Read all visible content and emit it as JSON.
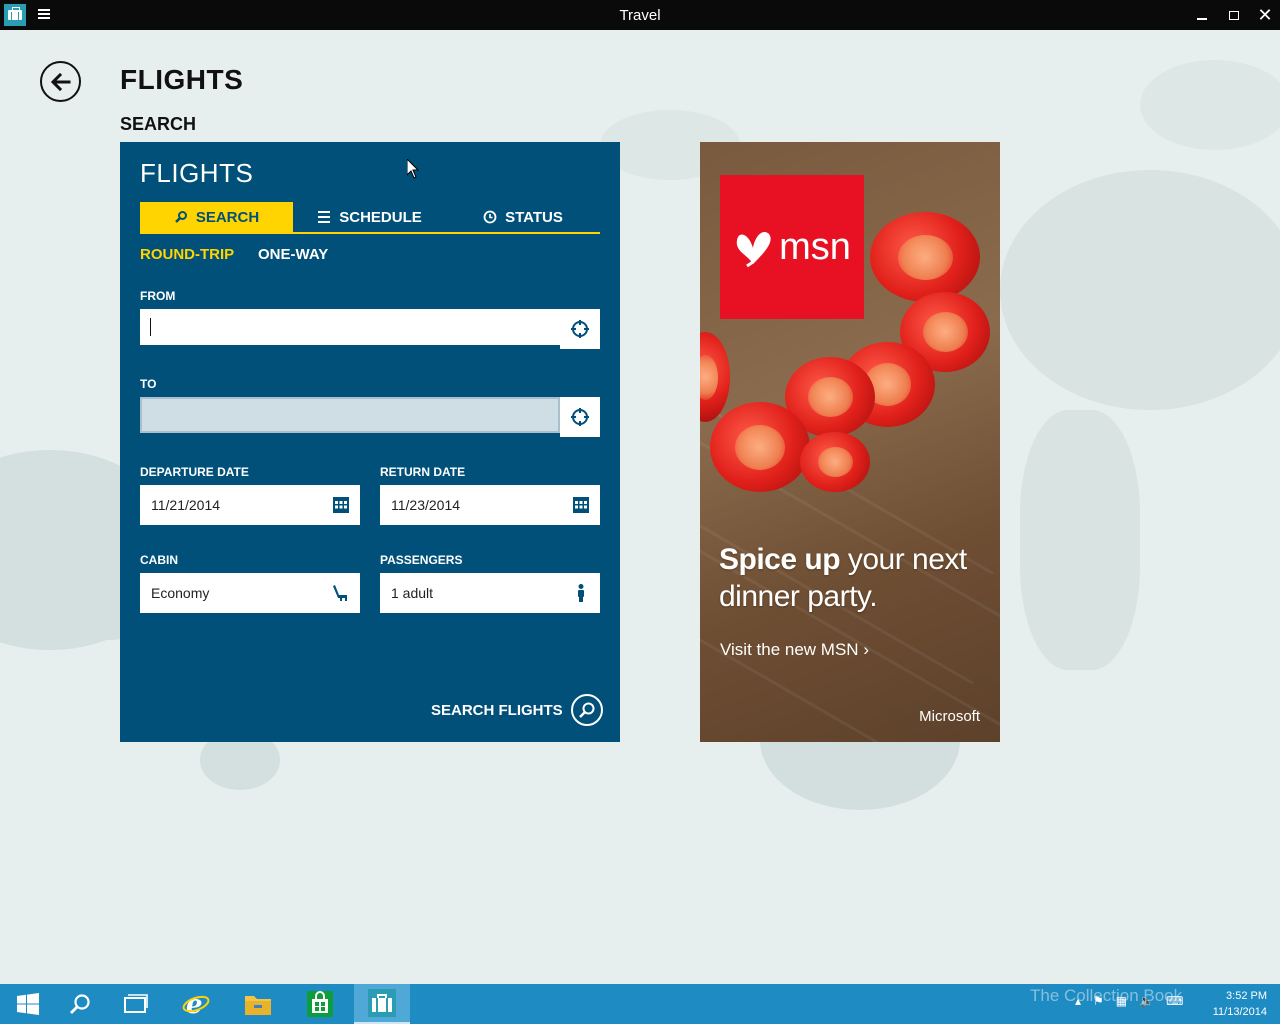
{
  "window": {
    "title": "Travel",
    "minimize_icon": "minimize-icon",
    "maximize_icon": "restore-icon",
    "close_icon": "close-icon"
  },
  "header": {
    "page_title": "FLIGHTS",
    "section_title": "SEARCH"
  },
  "panel": {
    "title": "FLIGHTS",
    "tabs": [
      {
        "label": "SEARCH",
        "icon": "search-icon",
        "active": true
      },
      {
        "label": "SCHEDULE",
        "icon": "list-icon",
        "active": false
      },
      {
        "label": "STATUS",
        "icon": "clock-icon",
        "active": false
      }
    ],
    "trip_types": [
      {
        "label": "ROUND-TRIP",
        "active": true
      },
      {
        "label": "ONE-WAY",
        "active": false
      }
    ],
    "from": {
      "label": "FROM",
      "value": "",
      "placeholder": ""
    },
    "to": {
      "label": "TO",
      "value": "",
      "placeholder": ""
    },
    "departure": {
      "label": "DEPARTURE DATE",
      "value": "11/21/2014"
    },
    "return": {
      "label": "RETURN DATE",
      "value": "11/23/2014"
    },
    "cabin": {
      "label": "CABIN",
      "value": "Economy"
    },
    "passengers": {
      "label": "PASSENGERS",
      "value": "1 adult"
    },
    "search_button": "SEARCH FLIGHTS"
  },
  "ad": {
    "logo_text": "msn",
    "headline_bold": "Spice up",
    "headline_rest": " your next dinner party.",
    "link": "Visit the new MSN",
    "link_chevron": "›",
    "brand": "Microsoft"
  },
  "taskbar": {
    "clock_time": "3:52 PM",
    "clock_date": "11/13/2014",
    "watermark": "The Collection Book"
  },
  "colors": {
    "panel_bg": "#00507a",
    "accent_yellow": "#ffd400",
    "taskbar": "#1e8bc3",
    "msn_red": "#e81123"
  }
}
